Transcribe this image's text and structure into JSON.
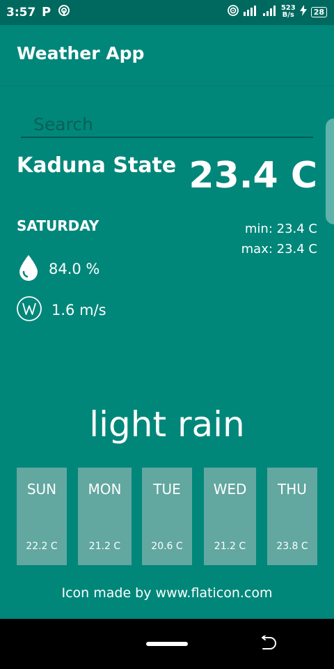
{
  "status_bar": {
    "time": "3:57",
    "app_icon_letter": "P",
    "net_speed_value": "523",
    "net_speed_unit": "B/s",
    "battery": "28"
  },
  "app_bar": {
    "title": "Weather App"
  },
  "search": {
    "placeholder": "Search",
    "value": ""
  },
  "current": {
    "city": "Kaduna State",
    "temperature": "23.4 C",
    "day": "SATURDAY",
    "min": "min: 23.4 C",
    "max": "max: 23.4 C",
    "humidity": "84.0 %",
    "wind": "1.6 m/s",
    "condition": "light rain"
  },
  "forecast": [
    {
      "day": "SUN",
      "temp": "22.2 C"
    },
    {
      "day": "MON",
      "temp": "21.2 C"
    },
    {
      "day": "TUE",
      "temp": "20.6 C"
    },
    {
      "day": "WED",
      "temp": "21.2 C"
    },
    {
      "day": "THU",
      "temp": "23.8 C"
    }
  ],
  "credit": "Icon made by www.flaticon.com",
  "icons": {
    "humidity": "water-drop-icon",
    "wind": "wind-w-icon"
  },
  "colors": {
    "background": "#00877a",
    "status_bar": "#00695f",
    "card": "#62a7a0",
    "search_underline": "#005a52"
  }
}
